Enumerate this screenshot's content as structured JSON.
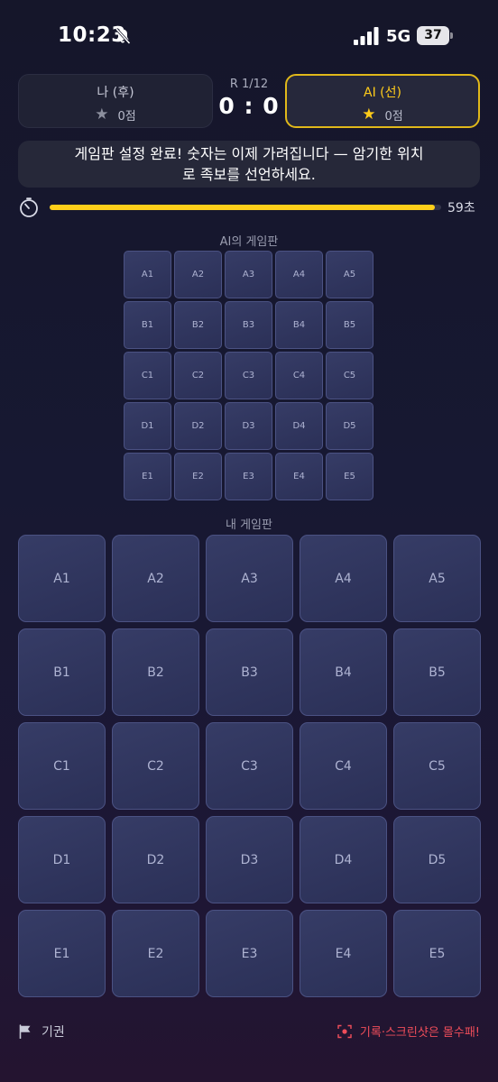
{
  "status_bar": {
    "time": "10:23",
    "network": "5G",
    "battery": "37"
  },
  "header": {
    "me": {
      "title": "나 (후)",
      "score": "0점"
    },
    "ai": {
      "title": "AI (선)",
      "score": "0점"
    },
    "round": "R 1/12",
    "score": "0 : 0"
  },
  "message": "게임판 설정 완료! 숫자는 이제 가려집니다 — 암기한 위치로 족보를 선언하세요.",
  "timer": {
    "label": "59초",
    "progress": 0.985
  },
  "ai_board": {
    "label": "AI의 게임판",
    "cells": [
      "A1",
      "A2",
      "A3",
      "A4",
      "A5",
      "B1",
      "B2",
      "B3",
      "B4",
      "B5",
      "C1",
      "C2",
      "C3",
      "C4",
      "C5",
      "D1",
      "D2",
      "D3",
      "D4",
      "D5",
      "E1",
      "E2",
      "E3",
      "E4",
      "E5"
    ]
  },
  "my_board": {
    "label": "내 게임판",
    "cells": [
      "A1",
      "A2",
      "A3",
      "A4",
      "A5",
      "B1",
      "B2",
      "B3",
      "B4",
      "B5",
      "C1",
      "C2",
      "C3",
      "C4",
      "C5",
      "D1",
      "D2",
      "D3",
      "D4",
      "D5",
      "E1",
      "E2",
      "E3",
      "E4",
      "E5"
    ]
  },
  "footer": {
    "forfeit_label": "기권",
    "warning": "기록·스크린샷은 몰수패!"
  },
  "colors": {
    "accent": "#ffcc1a",
    "warning": "#ef4d5a",
    "tile": "#2f3560"
  },
  "icons": [
    "bell-slash-icon",
    "signal-icon",
    "star-icon",
    "timer-icon",
    "flag-icon",
    "record-icon"
  ]
}
